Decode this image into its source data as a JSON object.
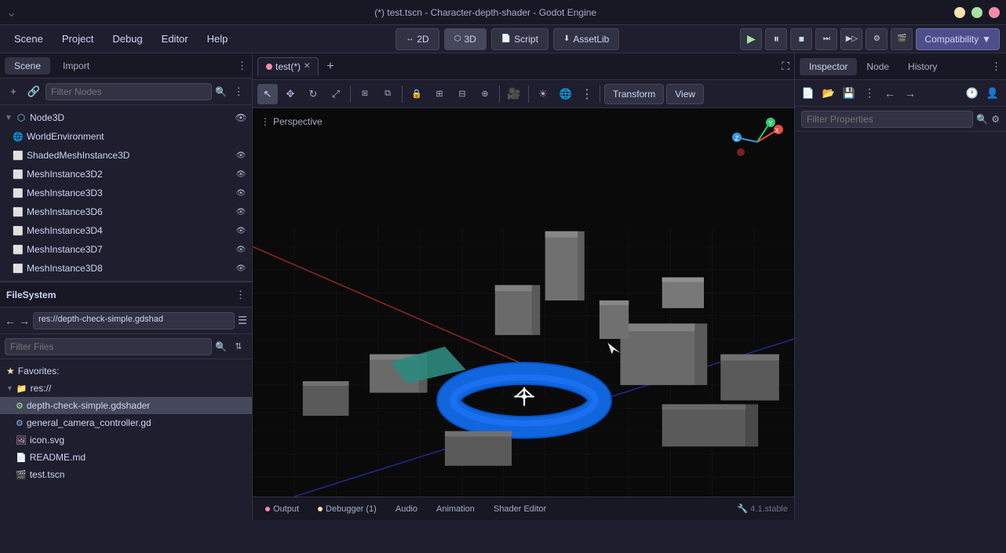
{
  "window": {
    "title": "(*) test.tscn - Character-depth-shader - Godot Engine"
  },
  "menu": {
    "items": [
      "Scene",
      "Project",
      "Debug",
      "Editor",
      "Help"
    ]
  },
  "toolbar": {
    "btn_2d": "2D",
    "btn_3d": "3D",
    "btn_script": "Script",
    "btn_assetlib": "AssetLib",
    "compat_label": "Compatibility",
    "compat_chevron": "▼"
  },
  "scene_panel": {
    "tabs": [
      "Scene",
      "Import"
    ],
    "filter_placeholder": "Filter Nodes"
  },
  "scene_tree": {
    "nodes": [
      {
        "label": "Node3D",
        "type": "node3d",
        "indent": 0,
        "has_arrow": true,
        "expanded": true,
        "has_vis": true
      },
      {
        "label": "WorldEnvironment",
        "type": "env",
        "indent": 1,
        "has_arrow": false,
        "has_vis": false
      },
      {
        "label": "ShadedMeshInstance3D",
        "type": "mesh",
        "indent": 1,
        "has_arrow": false,
        "has_vis": true
      },
      {
        "label": "MeshInstance3D2",
        "type": "mesh",
        "indent": 1,
        "has_arrow": false,
        "has_vis": true
      },
      {
        "label": "MeshInstance3D3",
        "type": "mesh",
        "indent": 1,
        "has_arrow": false,
        "has_vis": true
      },
      {
        "label": "MeshInstance3D6",
        "type": "mesh",
        "indent": 1,
        "has_arrow": false,
        "has_vis": true
      },
      {
        "label": "MeshInstance3D4",
        "type": "mesh",
        "indent": 1,
        "has_arrow": false,
        "has_vis": true
      },
      {
        "label": "MeshInstance3D7",
        "type": "mesh",
        "indent": 1,
        "has_arrow": false,
        "has_vis": true
      },
      {
        "label": "MeshInstance3D8",
        "type": "mesh",
        "indent": 1,
        "has_arrow": false,
        "has_vis": true
      }
    ]
  },
  "filesystem": {
    "title": "FileSystem",
    "path": "res://depth-check-simple.gdshad",
    "filter_placeholder": "Filter Files",
    "items": [
      {
        "label": "Favorites:",
        "type": "section",
        "indent": 0,
        "icon": "★"
      },
      {
        "label": "res://",
        "type": "folder",
        "indent": 0,
        "icon": "📁",
        "has_arrow": true,
        "expanded": true
      },
      {
        "label": "depth-check-simple.gdshader",
        "type": "shader",
        "indent": 1,
        "selected": true
      },
      {
        "label": "general_camera_controller.gd",
        "type": "script",
        "indent": 1
      },
      {
        "label": "icon.svg",
        "type": "image",
        "indent": 1
      },
      {
        "label": "README.md",
        "type": "doc",
        "indent": 1
      },
      {
        "label": "test.tscn",
        "type": "scene",
        "indent": 1
      }
    ]
  },
  "viewport": {
    "tab_label": "test(*)",
    "perspective_label": "Perspective",
    "view_btn": "Transform",
    "view_btn2": "View",
    "toolbar_tools": [
      "arrow",
      "move",
      "rotate",
      "scale",
      "ui",
      "group",
      "lock",
      "align",
      "snap",
      "pivot",
      "camera",
      "env",
      "lights",
      "more"
    ],
    "3d_label": "3D",
    "2d_label": "2D"
  },
  "bottom_bar": {
    "tabs": [
      {
        "label": "Output",
        "dot": "red"
      },
      {
        "label": "Debugger (1)",
        "dot": "yellow"
      },
      {
        "label": "Audio",
        "dot": null
      },
      {
        "label": "Animation",
        "dot": null
      },
      {
        "label": "Shader Editor",
        "dot": null
      }
    ],
    "version": "4.1.stable"
  },
  "inspector": {
    "tabs": [
      "Inspector",
      "Node",
      "History"
    ],
    "filter_placeholder": "Filter Properties"
  }
}
